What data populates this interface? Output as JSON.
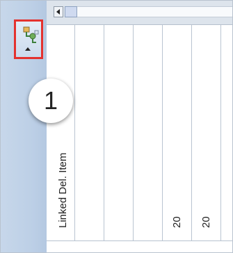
{
  "sidebar": {
    "tool_button": {
      "icon": "linked-items-icon",
      "expand_icon": "chevron-up-icon",
      "highlight_color": "#e4322f"
    }
  },
  "callout": {
    "number": "1"
  },
  "header": {
    "scroll_left_icon": "arrow-left-icon"
  },
  "row": {
    "label": "Linked Del. Item"
  },
  "grid": {
    "values": [
      "20",
      "20"
    ]
  }
}
